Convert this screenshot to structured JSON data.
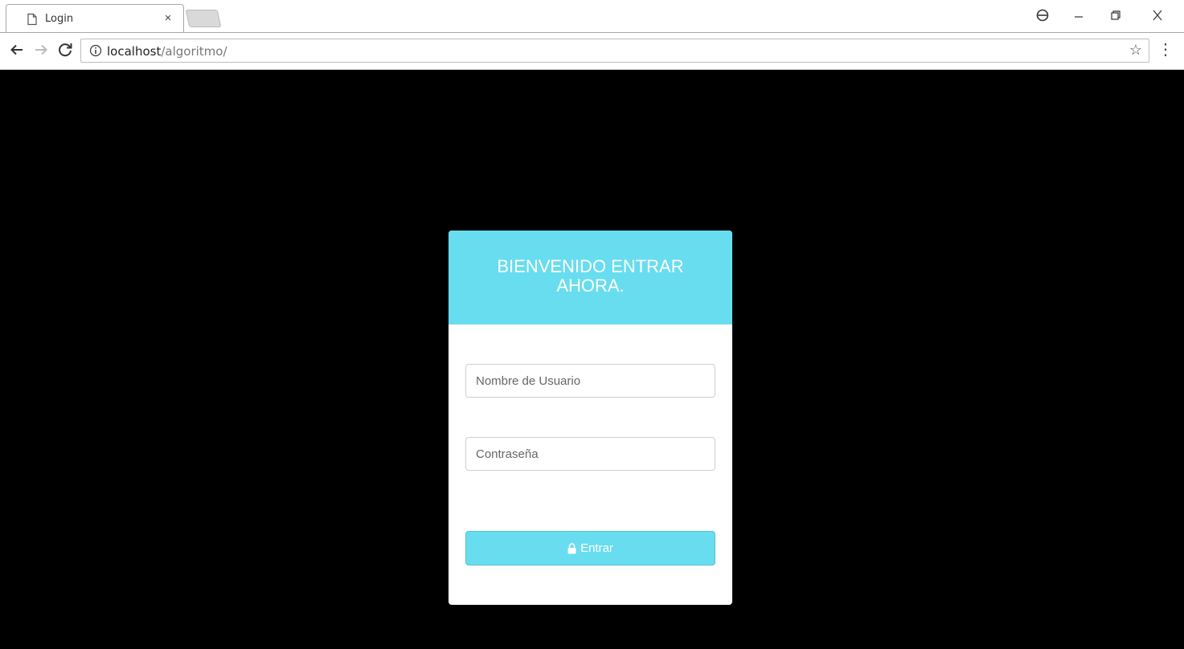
{
  "browser": {
    "tab_title": "Login",
    "tab_close": "×",
    "url_host": "localhost",
    "url_path": "/algoritmo/",
    "icons": {
      "tab": "page-icon",
      "close": "close-icon",
      "profile": "profile-icon",
      "minimize": "minimize-icon",
      "restore": "restore-icon",
      "window_close": "window-close-icon",
      "back": "back-arrow-icon",
      "forward": "forward-arrow-icon",
      "reload": "reload-icon",
      "info": "info-icon",
      "bookmark": "star-icon",
      "menu": "kebab-menu-icon"
    }
  },
  "login": {
    "title_line1": "BIENVENIDO ENTRAR",
    "title_line2": "AHORA.",
    "username_placeholder": "Nombre de Usuario",
    "password_placeholder": "Contraseña",
    "submit_label": "Entrar"
  },
  "colors": {
    "accent": "#68ddef",
    "page_background": "#000000",
    "card_background": "#ffffff"
  }
}
